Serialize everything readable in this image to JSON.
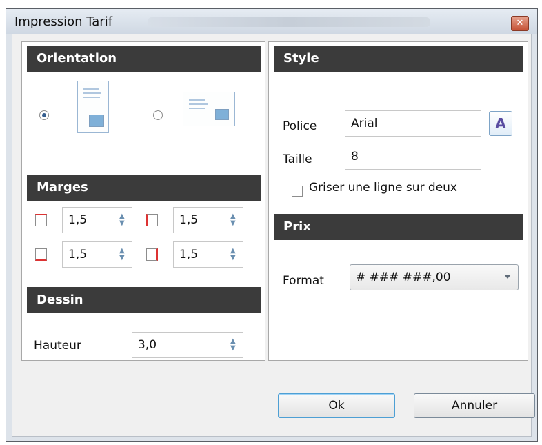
{
  "window": {
    "title": "Impression Tarif",
    "close_icon": "close-icon"
  },
  "left_panel": {
    "orientation": {
      "title": "Orientation",
      "portrait_selected": true
    },
    "marges": {
      "title": "Marges",
      "fields": [
        {
          "value": "1,5"
        },
        {
          "value": "1,5"
        },
        {
          "value": "1,5"
        },
        {
          "value": "1,5"
        }
      ]
    },
    "dessin": {
      "title": "Dessin",
      "height_label": "Hauteur",
      "height_value": "3,0"
    }
  },
  "right_panel": {
    "style": {
      "title": "Style",
      "police_label": "Police",
      "police_value": "Arial",
      "taille_label": "Taille",
      "taille_value": "8",
      "griser_label": "Griser une ligne sur deux"
    },
    "prix": {
      "title": "Prix",
      "format_label": "Format",
      "format_value": "# ### ###,00"
    }
  },
  "buttons": {
    "ok": "Ok",
    "cancel": "Annuler"
  }
}
